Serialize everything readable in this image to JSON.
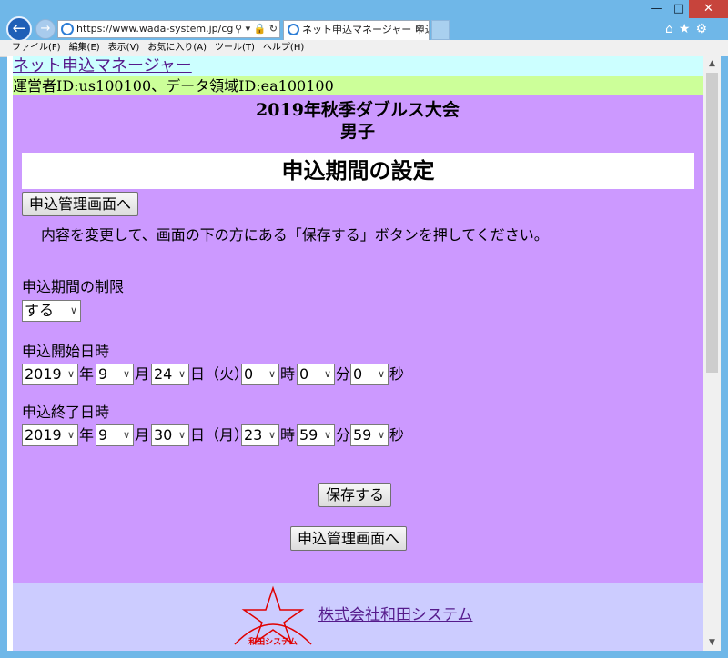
{
  "browser": {
    "url": "https://www.wada-system.jp/cgi-bir",
    "tab_title": "ネット申込マネージャー 申込...",
    "tab_close": "×",
    "menu": [
      "ファイル(F)",
      "編集(E)",
      "表示(V)",
      "お気に入り(A)",
      "ツール(T)",
      "ヘルプ(H)"
    ]
  },
  "site": {
    "title": "ネット申込マネージャー",
    "operator_line": "運営者ID:us100100、データ領域ID:ea100100"
  },
  "event": {
    "name": "2019年秋季ダブルス大会",
    "category": "男子"
  },
  "page": {
    "heading": "申込期間の設定",
    "back_button": "申込管理画面へ",
    "instruction": "内容を変更して、画面の下の方にある「保存する」ボタンを押してください。"
  },
  "form": {
    "limit": {
      "label": "申込期間の制限",
      "value": "する"
    },
    "start": {
      "label": "申込開始日時",
      "year": "2019",
      "month": "9",
      "day": "24",
      "weekday": "日（火）",
      "hour": "0",
      "minute": "0",
      "second": "0"
    },
    "end": {
      "label": "申込終了日時",
      "year": "2019",
      "month": "9",
      "day": "30",
      "weekday": "日（月）",
      "hour": "23",
      "minute": "59",
      "second": "59"
    },
    "units": {
      "year": "年",
      "month": "月",
      "hour": "時",
      "minute": "分",
      "second": "秒"
    },
    "save_button": "保存する",
    "bottom_back_button": "申込管理画面へ"
  },
  "footer": {
    "company": "株式会社和田システム",
    "logo_text": "和田システム"
  },
  "colors": {
    "header_bg": "#ccffff",
    "operator_bg": "#ccff99",
    "main_bg": "#cc99ff",
    "footer_bg": "#ccccff",
    "link": "#551a8b",
    "logo_red": "#e00000"
  }
}
